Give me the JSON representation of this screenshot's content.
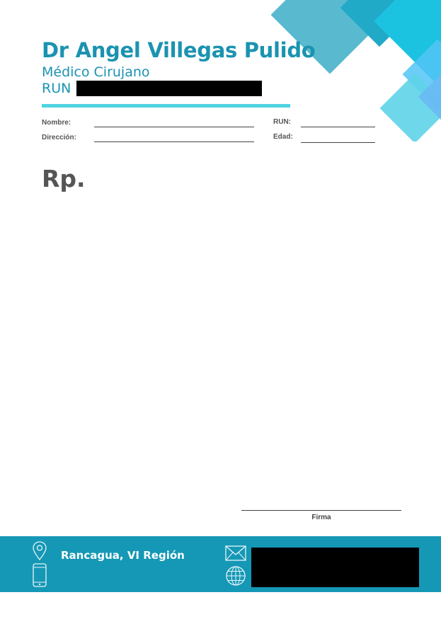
{
  "header": {
    "doctor_name": "Dr Angel Villegas Pulido",
    "specialty": "Médico Cirujano",
    "run_label": "RUN"
  },
  "patient_fields": {
    "nombre": "Nombre:",
    "direccion": "Dirección:",
    "run": "RUN:",
    "edad": "Edad:"
  },
  "body": {
    "rp_label": "Rp."
  },
  "signature": {
    "label": "Firma"
  },
  "footer": {
    "city": "Rancagua, VI Región",
    "icons": [
      "location-pin-icon",
      "phone-icon",
      "mail-icon",
      "globe-icon"
    ]
  },
  "colors": {
    "brand": "#1b93b0",
    "accent_line": "#4fd3e3",
    "footer_bg": "#1598b5"
  }
}
